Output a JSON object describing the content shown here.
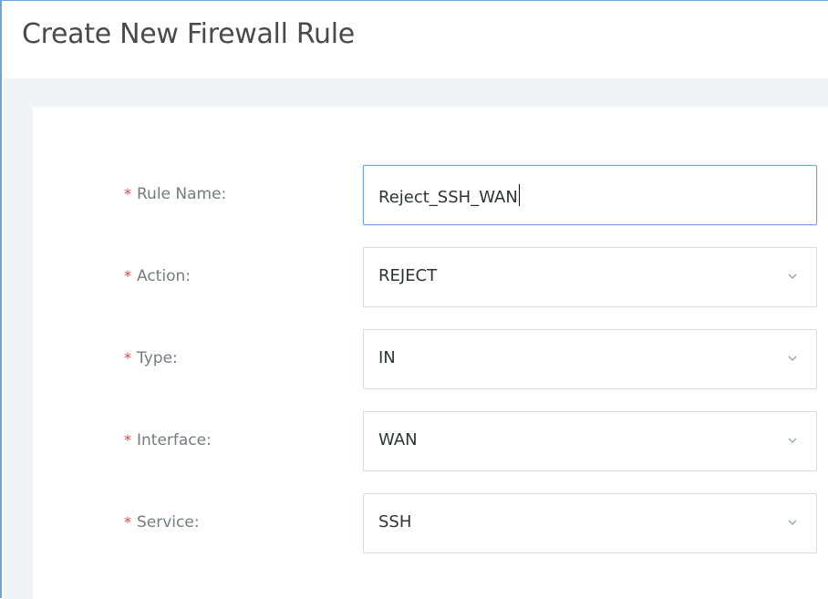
{
  "window": {
    "title": "Create New Firewall Rule"
  },
  "form": {
    "required_marker": "*",
    "fields": [
      {
        "label": "Rule Name:",
        "value": "Reject_SSH_WAN",
        "type": "text"
      },
      {
        "label": "Action:",
        "value": "REJECT",
        "type": "select"
      },
      {
        "label": "Type:",
        "value": "IN",
        "type": "select"
      },
      {
        "label": "Interface:",
        "value": "WAN",
        "type": "select"
      },
      {
        "label": "Service:",
        "value": "SSH",
        "type": "select"
      }
    ]
  },
  "icons": {
    "dropdown": "chevron-down-icon"
  },
  "colors": {
    "required": "#e0474c",
    "active_border": "#6aa5e6",
    "frame_border": "#6fa4d6"
  }
}
